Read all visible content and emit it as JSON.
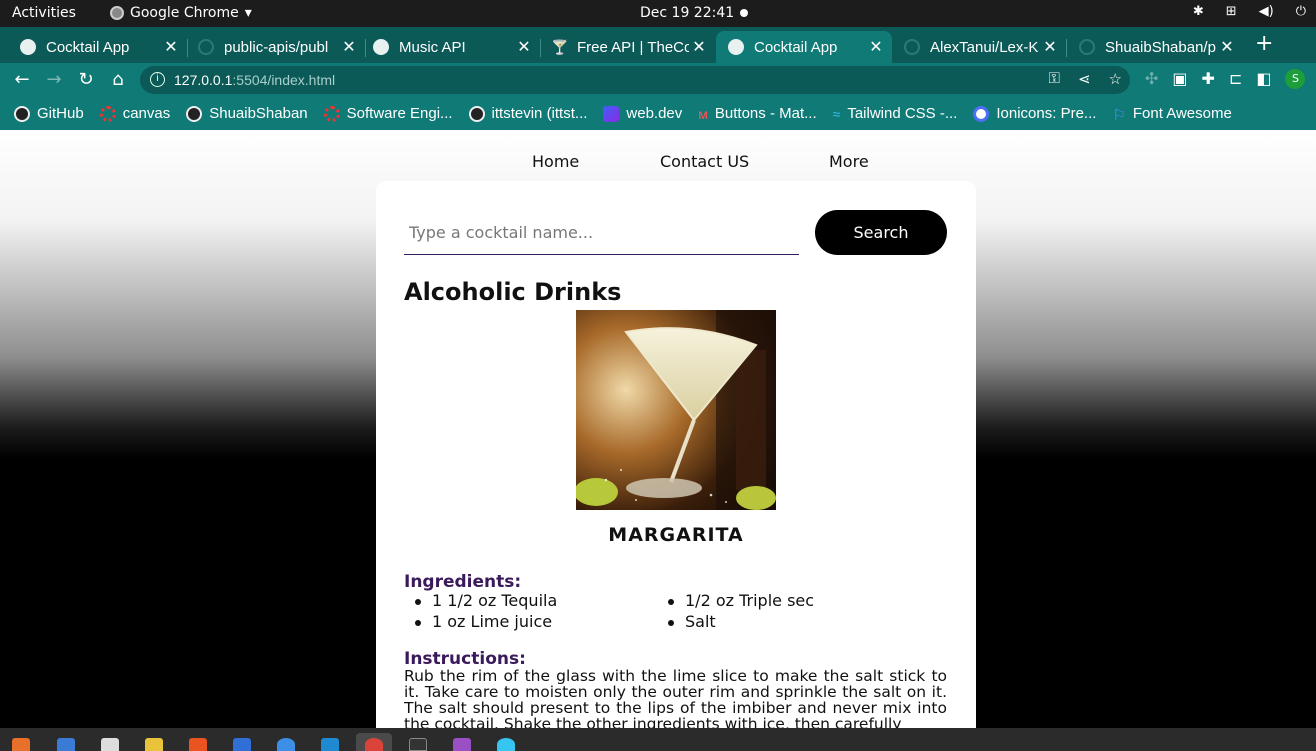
{
  "topbar": {
    "activities": "Activities",
    "app_name": "Google Chrome",
    "app_menu_arrow": "▾",
    "clock": "Dec 19  22:41"
  },
  "tabs": [
    {
      "title": "Cocktail App",
      "icon": "globe-icon",
      "active": false
    },
    {
      "title": "public-apis/publ",
      "icon": "github-icon",
      "active": false
    },
    {
      "title": "Music API",
      "icon": "globe-icon",
      "active": false
    },
    {
      "title": "Free API | TheCo",
      "icon": "cocktail-icon",
      "active": false
    },
    {
      "title": "Cocktail App",
      "icon": "globe-icon",
      "active": true
    },
    {
      "title": "AlexTanui/Lex-K",
      "icon": "github-icon",
      "active": false
    },
    {
      "title": "ShuaibShaban/p",
      "icon": "github-icon",
      "active": false
    }
  ],
  "toolbar": {
    "url_host": "127.0.0.1",
    "url_rest": ":5504/index.html",
    "profile_initial": "S"
  },
  "bookmarks": [
    {
      "label": "GitHub",
      "icon": "github-icon"
    },
    {
      "label": "canvas",
      "icon": "canvas-icon"
    },
    {
      "label": "ShuaibShaban",
      "icon": "github-icon"
    },
    {
      "label": "Software Engi...",
      "icon": "canvas-icon"
    },
    {
      "label": "ittstevin (ittst...",
      "icon": "github-icon"
    },
    {
      "label": "web.dev",
      "icon": "webdev-icon"
    },
    {
      "label": "Buttons - Mat...",
      "icon": "material-icon"
    },
    {
      "label": "Tailwind CSS -...",
      "icon": "tailwind-icon"
    },
    {
      "label": "Ionicons: Pre...",
      "icon": "ionicons-icon"
    },
    {
      "label": "Font Awesome",
      "icon": "flag-icon"
    }
  ],
  "site_nav": {
    "home": "Home",
    "contact": "Contact US",
    "more": "More"
  },
  "search": {
    "placeholder": "Type a cocktail name...",
    "button": "Search"
  },
  "section_title": "Alcoholic Drinks",
  "drink": {
    "name": "MARGARITA",
    "ingredients_label": "Ingredients:",
    "ingredients_left": [
      "1 1/2 oz Tequila",
      "1 oz Lime juice"
    ],
    "ingredients_right": [
      "1/2 oz Triple sec",
      "Salt"
    ],
    "instructions_label": "Instructions:",
    "instructions": "Rub the rim of the glass with the lime slice to make the salt stick to it. Take care to moisten only the outer rim and sprinkle the salt on it. The salt should present to the lips of the imbiber and never mix into the cocktail. Shake the other ingredients with ice, then carefully"
  },
  "colors": {
    "tab_strip": "#0b5a57",
    "toolbar": "#0f7a76",
    "accent_purple": "#3b1a5c",
    "button_black": "#000000"
  }
}
